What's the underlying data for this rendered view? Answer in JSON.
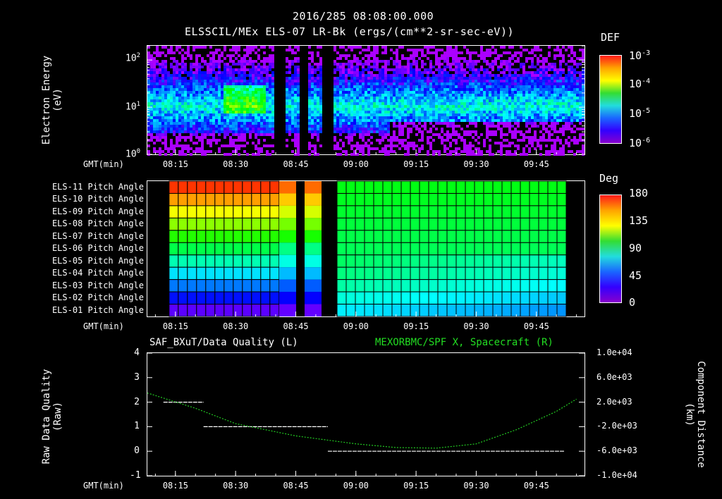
{
  "header": {
    "timestamp": "2016/285 08:08:00.000",
    "subtitle": "ELSSCIL/MEx ELS-07 LR-Bk  (ergs/(cm**2-sr-sec-eV))"
  },
  "time_axis": {
    "label": "GMT(min)",
    "ticks": [
      "08:15",
      "08:30",
      "08:45",
      "09:00",
      "09:15",
      "09:30",
      "09:45"
    ]
  },
  "panel1": {
    "ylabel_line1": "Electron Energy",
    "ylabel_line2": "(eV)",
    "yticks": [
      "10",
      "10",
      "10"
    ],
    "ytick_exps": [
      "2",
      "1",
      "0"
    ],
    "colorbar_title": "DEF",
    "colorbar_ticks": [
      "10",
      "10",
      "10",
      "10"
    ],
    "colorbar_exps": [
      "-3",
      "-4",
      "-5",
      "-6"
    ]
  },
  "panel2": {
    "rows": [
      "ELS-11 Pitch Angle",
      "ELS-10 Pitch Angle",
      "ELS-09 Pitch Angle",
      "ELS-08 Pitch Angle",
      "ELS-07 Pitch Angle",
      "ELS-06 Pitch Angle",
      "ELS-05 Pitch Angle",
      "ELS-04 Pitch Angle",
      "ELS-03 Pitch Angle",
      "ELS-02 Pitch Angle",
      "ELS-01 Pitch Angle"
    ],
    "colorbar_title": "Deg",
    "colorbar_ticks": [
      "180",
      "135",
      "90",
      "45",
      "0"
    ]
  },
  "panel3": {
    "title_left": "SAF_BXuT/Data Quality (L)",
    "title_right": "MEXORBMC/SPF X, Spacecraft (R)",
    "ylabel_left_line1": "Raw Data Quality",
    "ylabel_left_line2": "(Raw)",
    "ylabel_right_line1": "Component Distance",
    "ylabel_right_line2": "(km)",
    "left_ticks": [
      "4",
      "3",
      "2",
      "1",
      "0",
      "-1"
    ],
    "right_ticks": [
      "1.0e+04",
      "6.0e+03",
      "2.0e+03",
      "-2.0e+03",
      "-6.0e+03",
      "-1.0e+04"
    ]
  },
  "colors": {
    "trace": "#22cc22",
    "axes": "#ffffff",
    "background": "#000000"
  },
  "chart_data": [
    {
      "type": "heatmap",
      "title": "ELSSCIL/MEx ELS-07 LR-Bk  (ergs/(cm**2-sr-sec-eV))",
      "xlabel": "GMT(min)",
      "ylabel": "Electron Energy (eV)",
      "yscale": "log",
      "ylim": [
        1,
        200
      ],
      "zlabel": "DEF",
      "zscale": "log",
      "zlim": [
        1e-06,
        0.001
      ],
      "x_ticks": [
        "08:15",
        "08:30",
        "08:45",
        "09:00",
        "09:15",
        "09:30",
        "09:45"
      ],
      "data_gaps": [
        [
          "08:40",
          "08:42"
        ],
        [
          "08:46",
          "08:48"
        ],
        [
          "08:52",
          "08:54"
        ]
      ]
    },
    {
      "type": "heatmap",
      "xlabel": "GMT(min)",
      "categories": [
        "ELS-11",
        "ELS-10",
        "ELS-09",
        "ELS-08",
        "ELS-07",
        "ELS-06",
        "ELS-05",
        "ELS-04",
        "ELS-03",
        "ELS-02",
        "ELS-01"
      ],
      "zlabel": "Deg",
      "zlim": [
        0,
        180
      ],
      "series": [
        {
          "x": "08:15-08:39",
          "values": [
            172,
            156,
            140,
            124,
            108,
            92,
            76,
            60,
            44,
            28,
            12
          ]
        },
        {
          "x": "08:56-09:52",
          "values": [
            100,
            98,
            96,
            94,
            92,
            90,
            88,
            84,
            78,
            70,
            62
          ]
        }
      ]
    },
    {
      "type": "line",
      "title": "SAF_BXuT/Data Quality (L)",
      "ylabel": "Raw Data Quality (Raw)",
      "ylim": [
        -1,
        4
      ],
      "series": [
        {
          "name": "SAF_BXuT/Data Quality",
          "x": [
            "08:12",
            "08:22",
            "08:22",
            "08:53",
            "08:53",
            "09:52"
          ],
          "values": [
            2,
            2,
            1,
            1,
            0,
            0
          ]
        }
      ]
    },
    {
      "type": "line",
      "title": "MEXORBMC/SPF X, Spacecraft (R)",
      "ylabel": "Component Distance (km)",
      "ylim": [
        -10000,
        10000
      ],
      "series": [
        {
          "name": "MEXORBMC/SPF X, Spacecraft",
          "x": [
            "08:08",
            "08:20",
            "08:30",
            "08:45",
            "09:00",
            "09:10",
            "09:20",
            "09:30",
            "09:40",
            "09:50",
            "09:55"
          ],
          "values": [
            3500,
            1000,
            -1500,
            -3500,
            -4800,
            -5400,
            -5500,
            -4800,
            -2500,
            500,
            2500
          ]
        }
      ]
    }
  ]
}
